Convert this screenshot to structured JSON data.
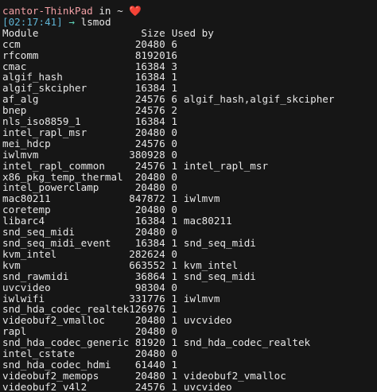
{
  "prompt": {
    "host": "cantor-ThinkPad",
    "in_word": "in",
    "dir": "~",
    "heart": "❤️",
    "time": "[02:17:41]",
    "arrow": "→",
    "command": "lsmod"
  },
  "table": {
    "header": {
      "module": "Module",
      "size": "Size",
      "used": "Used by"
    },
    "rows": [
      {
        "module": "ccm",
        "size": "20480",
        "used": "6",
        "by": ""
      },
      {
        "module": "rfcomm",
        "size": "81920",
        "used": "16",
        "by": ""
      },
      {
        "module": "cmac",
        "size": "16384",
        "used": "3",
        "by": ""
      },
      {
        "module": "algif_hash",
        "size": "16384",
        "used": "1",
        "by": ""
      },
      {
        "module": "algif_skcipher",
        "size": "16384",
        "used": "1",
        "by": ""
      },
      {
        "module": "af_alg",
        "size": "24576",
        "used": "6",
        "by": "algif_hash,algif_skcipher"
      },
      {
        "module": "bnep",
        "size": "24576",
        "used": "2",
        "by": ""
      },
      {
        "module": "nls_iso8859_1",
        "size": "16384",
        "used": "1",
        "by": ""
      },
      {
        "module": "intel_rapl_msr",
        "size": "20480",
        "used": "0",
        "by": ""
      },
      {
        "module": "mei_hdcp",
        "size": "24576",
        "used": "0",
        "by": ""
      },
      {
        "module": "iwlmvm",
        "size": "380928",
        "used": "0",
        "by": ""
      },
      {
        "module": "intel_rapl_common",
        "size": "24576",
        "used": "1",
        "by": "intel_rapl_msr"
      },
      {
        "module": "x86_pkg_temp_thermal",
        "size": "20480",
        "used": "0",
        "by": ""
      },
      {
        "module": "intel_powerclamp",
        "size": "20480",
        "used": "0",
        "by": ""
      },
      {
        "module": "mac80211",
        "size": "847872",
        "used": "1",
        "by": "iwlmvm"
      },
      {
        "module": "coretemp",
        "size": "20480",
        "used": "0",
        "by": ""
      },
      {
        "module": "libarc4",
        "size": "16384",
        "used": "1",
        "by": "mac80211"
      },
      {
        "module": "snd_seq_midi",
        "size": "20480",
        "used": "0",
        "by": ""
      },
      {
        "module": "snd_seq_midi_event",
        "size": "16384",
        "used": "1",
        "by": "snd_seq_midi"
      },
      {
        "module": "kvm_intel",
        "size": "282624",
        "used": "0",
        "by": ""
      },
      {
        "module": "kvm",
        "size": "663552",
        "used": "1",
        "by": "kvm_intel"
      },
      {
        "module": "snd_rawmidi",
        "size": "36864",
        "used": "1",
        "by": "snd_seq_midi"
      },
      {
        "module": "uvcvideo",
        "size": "98304",
        "used": "0",
        "by": ""
      },
      {
        "module": "iwlwifi",
        "size": "331776",
        "used": "1",
        "by": "iwlmvm"
      },
      {
        "module": "snd_hda_codec_realtek",
        "size": "126976",
        "used": "1",
        "by": ""
      },
      {
        "module": "videobuf2_vmalloc",
        "size": "20480",
        "used": "1",
        "by": "uvcvideo"
      },
      {
        "module": "rapl",
        "size": "20480",
        "used": "0",
        "by": ""
      },
      {
        "module": "snd_hda_codec_generic",
        "size": "81920",
        "used": "1",
        "by": "snd_hda_codec_realtek"
      },
      {
        "module": "intel_cstate",
        "size": "20480",
        "used": "0",
        "by": ""
      },
      {
        "module": "snd_hda_codec_hdmi",
        "size": "61440",
        "used": "1",
        "by": ""
      },
      {
        "module": "videobuf2_memops",
        "size": "20480",
        "used": "1",
        "by": "videobuf2_vmalloc"
      },
      {
        "module": "videobuf2_v4l2",
        "size": "24576",
        "used": "1",
        "by": "uvcvideo"
      }
    ]
  }
}
